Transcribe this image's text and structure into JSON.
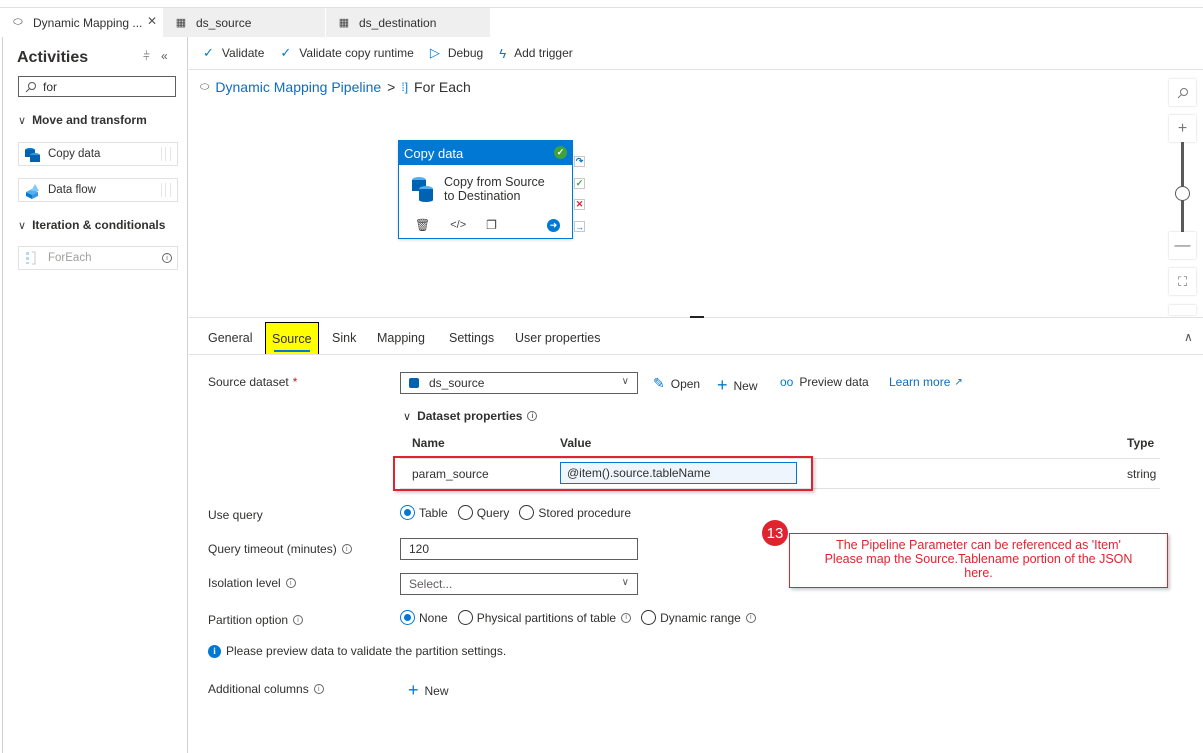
{
  "tabs": [
    {
      "label": "Dynamic Mapping ...",
      "icon": "pipeline-icon",
      "active": true,
      "closable": true
    },
    {
      "label": "ds_source",
      "icon": "table-icon",
      "active": false
    },
    {
      "label": "ds_destination",
      "icon": "table-icon",
      "active": false
    }
  ],
  "sidebar": {
    "title": "Activities",
    "search": {
      "value": "for",
      "placeholder": ""
    },
    "sections": [
      {
        "label": "Move and transform",
        "items": [
          {
            "label": "Copy data",
            "icon": "copy-data-icon"
          },
          {
            "label": "Data flow",
            "icon": "data-flow-icon"
          }
        ]
      },
      {
        "label": "Iteration & conditionals",
        "items": [
          {
            "label": "ForEach",
            "icon": "foreach-icon",
            "disabled": true
          }
        ]
      }
    ]
  },
  "toolbar": {
    "validate": "Validate",
    "validate_runtime": "Validate copy runtime",
    "debug": "Debug",
    "add_trigger": "Add trigger"
  },
  "breadcrumb": {
    "pipeline": "Dynamic Mapping Pipeline",
    "separator": ">",
    "current": "For Each"
  },
  "node": {
    "type": "Copy data",
    "name_line1": "Copy from Source",
    "name_line2": "to Destination",
    "status": "valid"
  },
  "properties": {
    "tabs": [
      "General",
      "Source",
      "Sink",
      "Mapping",
      "Settings",
      "User properties"
    ],
    "active_tab": "Source",
    "source_dataset": {
      "label": "Source dataset",
      "required": "*",
      "value": "ds_source"
    },
    "actions": {
      "open": "Open",
      "new": "New",
      "preview": "Preview data",
      "learn_more": "Learn more"
    },
    "dataset_properties": {
      "label": "Dataset properties",
      "columns": [
        "Name",
        "Value",
        "Type"
      ],
      "rows": [
        {
          "name": "param_source",
          "value": "@item().source.tableName",
          "type": "string"
        }
      ]
    },
    "use_query": {
      "label": "Use query",
      "options": [
        "Table",
        "Query",
        "Stored procedure"
      ],
      "selected": "Table"
    },
    "query_timeout": {
      "label": "Query timeout (minutes)",
      "value": "120"
    },
    "isolation_level": {
      "label": "Isolation level",
      "placeholder": "Select..."
    },
    "partition_option": {
      "label": "Partition option",
      "options": [
        "None",
        "Physical partitions of table",
        "Dynamic range"
      ],
      "selected": "None"
    },
    "notice": "Please preview data to validate the partition settings.",
    "additional_columns": {
      "label": "Additional columns",
      "new": "New"
    }
  },
  "annotation": {
    "badge": "13",
    "line1": "The Pipeline Parameter can be referenced as 'Item'",
    "line2": "Please map the Source.Tablename portion of the JSON",
    "line3": "here."
  },
  "colors": {
    "accent": "#0078d4",
    "highlight": "#ffff00",
    "annotation": "#e0242f"
  }
}
